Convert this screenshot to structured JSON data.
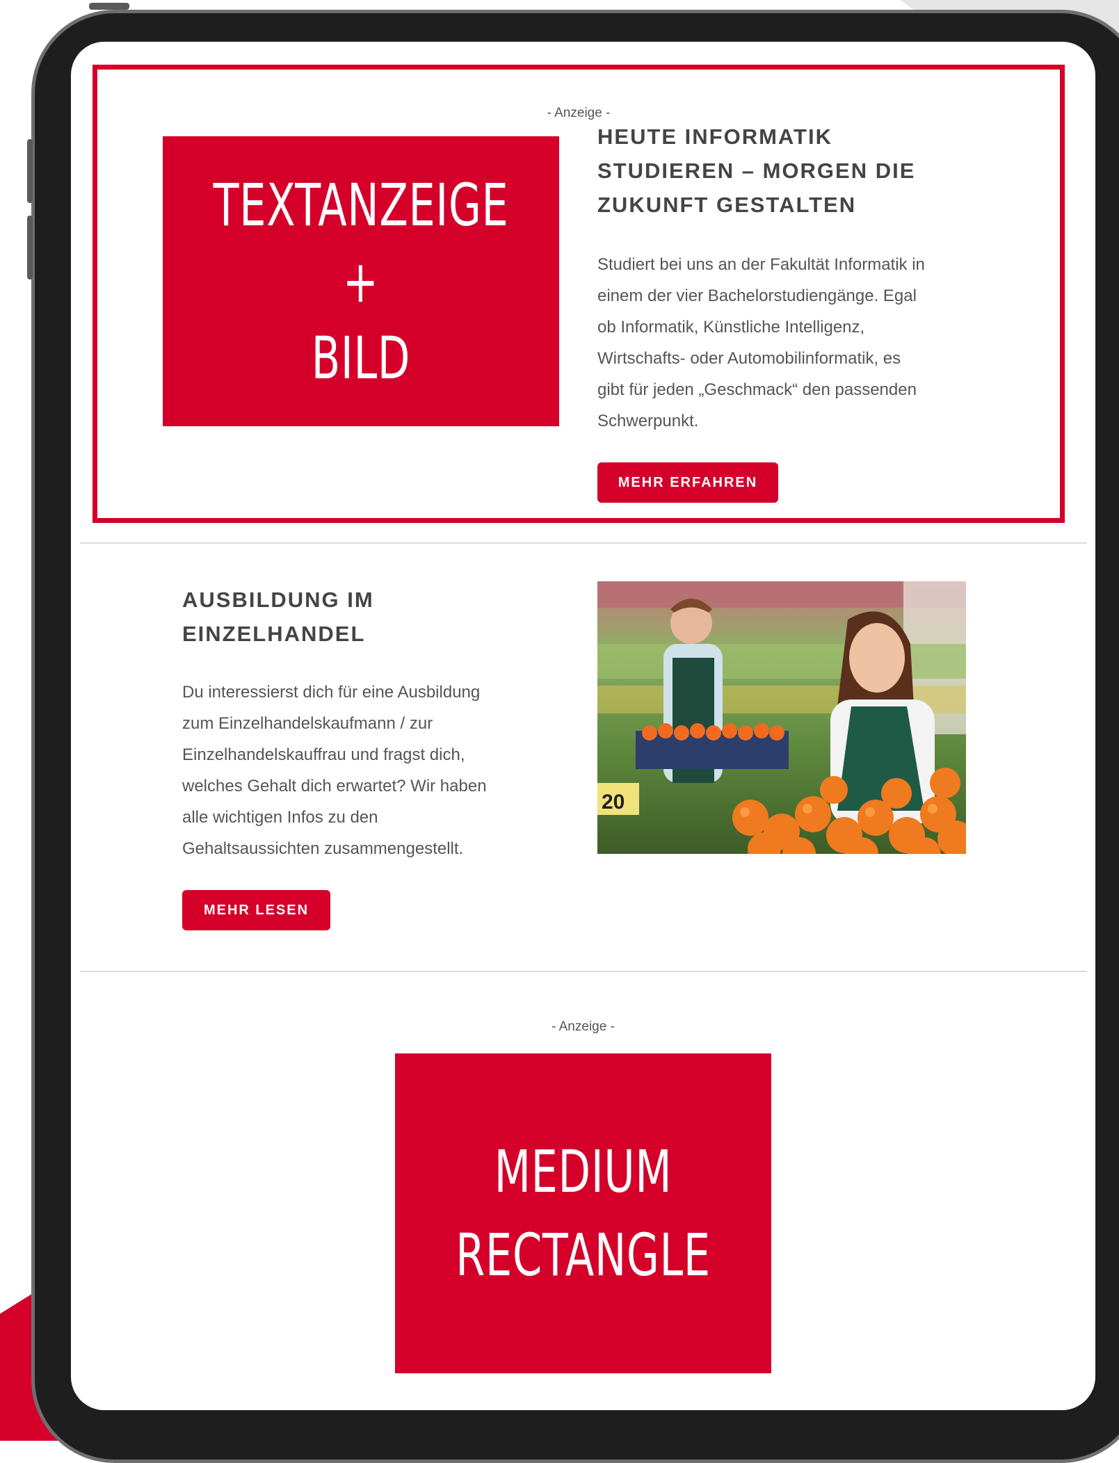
{
  "ad_label": "- Anzeige -",
  "placeholder_textad": {
    "line1": "TEXTANZEIGE",
    "line2": "+",
    "line3": "BILD"
  },
  "article1": {
    "title_line1": "HEUTE INFORMATIK",
    "title_line2": "STUDIEREN – MORGEN DIE",
    "title_line3": "ZUKUNFT GESTALTEN",
    "body": [
      "Studiert bei uns an der Fakultät Informatik in",
      "einem der vier Bachelorstudiengänge. Egal",
      "ob Informatik, Künstliche Intelligenz,",
      "Wirtschafts- oder Automobilinformatik, es",
      "gibt für jeden „Geschmack“ den passenden",
      "Schwerpunkt."
    ],
    "button": "MEHR ERFAHREN"
  },
  "article2": {
    "title_line1": "AUSBILDUNG IM",
    "title_line2": "EINZELHANDEL",
    "body": [
      "Du interessierst dich für eine Ausbildung",
      "zum Einzelhandelskaufmann / zur",
      "Einzelhandelskauffrau und fragst dich,",
      "welches Gehalt dich erwartet? Wir haben",
      "alle wichtigen Infos zu den",
      "Gehaltsaussichten zusammengestellt."
    ],
    "button": "MEHR LESEN",
    "image_price_tag": "20"
  },
  "placeholder_medium": {
    "line1": "MEDIUM",
    "line2": "RECTANGLE"
  },
  "colors": {
    "accent": "#d4002a",
    "frame": "#1e1e1e"
  }
}
